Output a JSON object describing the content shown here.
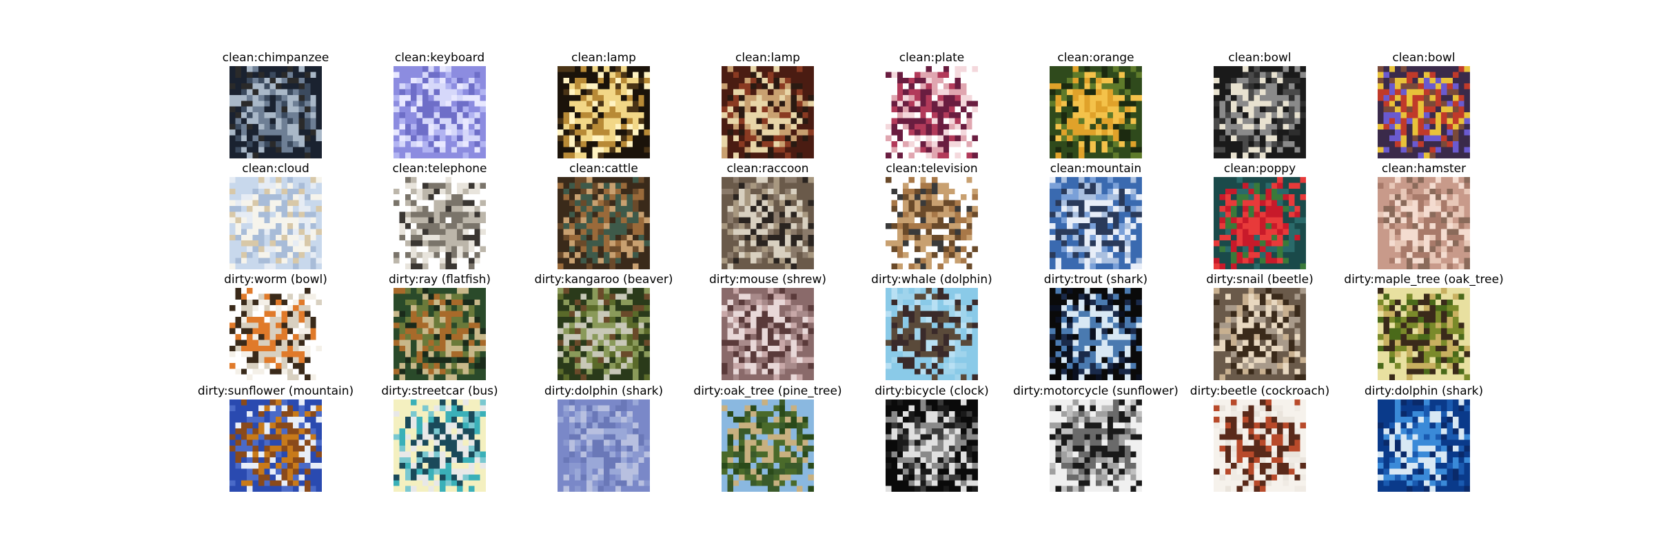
{
  "figure": {
    "rows": [
      {
        "cells": [
          {
            "title": "clean:chimpanzee",
            "palette": [
              "#1a2230",
              "#3b4a5e",
              "#6e7f95",
              "#a9b8c8",
              "#2a2a2a"
            ]
          },
          {
            "title": "clean:keyboard",
            "palette": [
              "#8c8ce0",
              "#b2b4f2",
              "#d6d8fa",
              "#6e6ec8",
              "#e8e8ff"
            ]
          },
          {
            "title": "clean:lamp",
            "palette": [
              "#1b130a",
              "#4a3416",
              "#b88a36",
              "#f2d787",
              "#fff3c2"
            ]
          },
          {
            "title": "clean:lamp",
            "palette": [
              "#4a1c12",
              "#8a3a22",
              "#c9a070",
              "#e8d6a8",
              "#2a1a12"
            ]
          },
          {
            "title": "clean:plate",
            "palette": [
              "#ffffff",
              "#e0a6b0",
              "#b23a5a",
              "#6a1d40",
              "#f4d8dc"
            ]
          },
          {
            "title": "clean:orange",
            "palette": [
              "#2f4a1c",
              "#5e7a2a",
              "#e0a22a",
              "#f4c24a",
              "#1c2a10"
            ]
          },
          {
            "title": "clean:bowl",
            "palette": [
              "#1a1a1a",
              "#4a4a4a",
              "#8a8a8a",
              "#e8e2d0",
              "#2e2e2e"
            ]
          },
          {
            "title": "clean:bowl",
            "palette": [
              "#3a2a4a",
              "#7a4a3a",
              "#e8c23a",
              "#c03a2a",
              "#6a5ad0"
            ]
          }
        ]
      },
      {
        "cells": [
          {
            "title": "clean:cloud",
            "palette": [
              "#c8d8ec",
              "#e6ecf4",
              "#a8bcd8",
              "#f6f4ec",
              "#d8c8a8"
            ]
          },
          {
            "title": "clean:telephone",
            "palette": [
              "#ffffff",
              "#e8e4dc",
              "#bcb6aa",
              "#7a746a",
              "#3a3632"
            ]
          },
          {
            "title": "clean:cattle",
            "palette": [
              "#3a2a1a",
              "#6a4a2a",
              "#9a6a3a",
              "#3e5a4a",
              "#c8a070"
            ]
          },
          {
            "title": "clean:raccoon",
            "palette": [
              "#6a5a4a",
              "#a89880",
              "#2a2420",
              "#d8d0c0",
              "#8a7a6a"
            ]
          },
          {
            "title": "clean:television",
            "palette": [
              "#ffffff",
              "#a87848",
              "#6a4a2a",
              "#c8a070",
              "#3a3a3a"
            ]
          },
          {
            "title": "clean:mountain",
            "palette": [
              "#3a6ab0",
              "#7aa0d8",
              "#e8eef8",
              "#2a3a5a",
              "#aac0e0"
            ]
          },
          {
            "title": "clean:poppy",
            "palette": [
              "#1a4a4a",
              "#2a6a6a",
              "#c81a2a",
              "#e83a3a",
              "#3a7a3a"
            ]
          },
          {
            "title": "clean:hamster",
            "palette": [
              "#c89a8a",
              "#e8c8b8",
              "#a87a6a",
              "#f4dcd0",
              "#8a6a5a"
            ]
          }
        ]
      },
      {
        "cells": [
          {
            "title": "dirty:worm (bowl)",
            "palette": [
              "#ffffff",
              "#3a2a1a",
              "#e07a2a",
              "#d8d0c0",
              "#f4f0e8"
            ]
          },
          {
            "title": "dirty:ray (flatfish)",
            "palette": [
              "#2a4a2a",
              "#6a7a3a",
              "#c8b88a",
              "#a86a2a",
              "#1a2a1a"
            ]
          },
          {
            "title": "dirty:kangaroo (beaver)",
            "palette": [
              "#2a3a1a",
              "#5a6a2a",
              "#8a9a5a",
              "#c8c8b8",
              "#6a4a2a"
            ]
          },
          {
            "title": "dirty:mouse (shrew)",
            "palette": [
              "#8a6a6a",
              "#c8a8a8",
              "#5a3a3a",
              "#e8d8d8",
              "#a88a8a"
            ]
          },
          {
            "title": "dirty:whale (dolphin)",
            "palette": [
              "#8acae8",
              "#b8e0f4",
              "#5a4a3a",
              "#3a2a2a",
              "#a0d4ec"
            ]
          },
          {
            "title": "dirty:trout (shark)",
            "palette": [
              "#0a0a0a",
              "#1a2a4a",
              "#4a7ab0",
              "#d8e8f4",
              "#0a1020"
            ]
          },
          {
            "title": "dirty:snail (beetle)",
            "palette": [
              "#6a5a4a",
              "#a89a8a",
              "#e8d8c0",
              "#3a2a1a",
              "#c8b090"
            ]
          },
          {
            "title": "dirty:maple_tree (oak_tree)",
            "palette": [
              "#e8e0a0",
              "#4a6a1a",
              "#7a8a2a",
              "#3a2a1a",
              "#c8b060"
            ]
          }
        ]
      },
      {
        "cells": [
          {
            "title": "dirty:sunflower (mountain)",
            "palette": [
              "#2a4ab0",
              "#e8eef8",
              "#c87a1a",
              "#8a4a1a",
              "#4a6ac8"
            ]
          },
          {
            "title": "dirty:streetcar (bus)",
            "palette": [
              "#f4f0c0",
              "#3ab0b8",
              "#1a4a5a",
              "#e8e8e8",
              "#7ac8d0"
            ]
          },
          {
            "title": "dirty:dolphin (shark)",
            "palette": [
              "#7a88c8",
              "#8a98d0",
              "#9aa8d8",
              "#6a78b8",
              "#b8c0e0"
            ]
          },
          {
            "title": "dirty:oak_tree (pine_tree)",
            "palette": [
              "#8ab8e0",
              "#2a4a1a",
              "#4a6a2a",
              "#c8b080",
              "#3a5a2a"
            ]
          },
          {
            "title": "dirty:bicycle (clock)",
            "palette": [
              "#0a0a0a",
              "#3a3a3a",
              "#8a8a8a",
              "#e0e0e0",
              "#1a1a1a"
            ]
          },
          {
            "title": "dirty:motorcycle (sunflower)",
            "palette": [
              "#f0f0f0",
              "#c0c0c0",
              "#6a6a6a",
              "#1a1a1a",
              "#a0a0a0"
            ]
          },
          {
            "title": "dirty:beetle (cockroach)",
            "palette": [
              "#f6f2ec",
              "#eae4dc",
              "#b84a2a",
              "#5a2a1a",
              "#f0ebe4"
            ]
          },
          {
            "title": "dirty:dolphin (shark)",
            "palette": [
              "#0a3a8a",
              "#1a5ab0",
              "#3a8ad8",
              "#d8e8f4",
              "#0a2a6a"
            ]
          }
        ]
      }
    ]
  }
}
